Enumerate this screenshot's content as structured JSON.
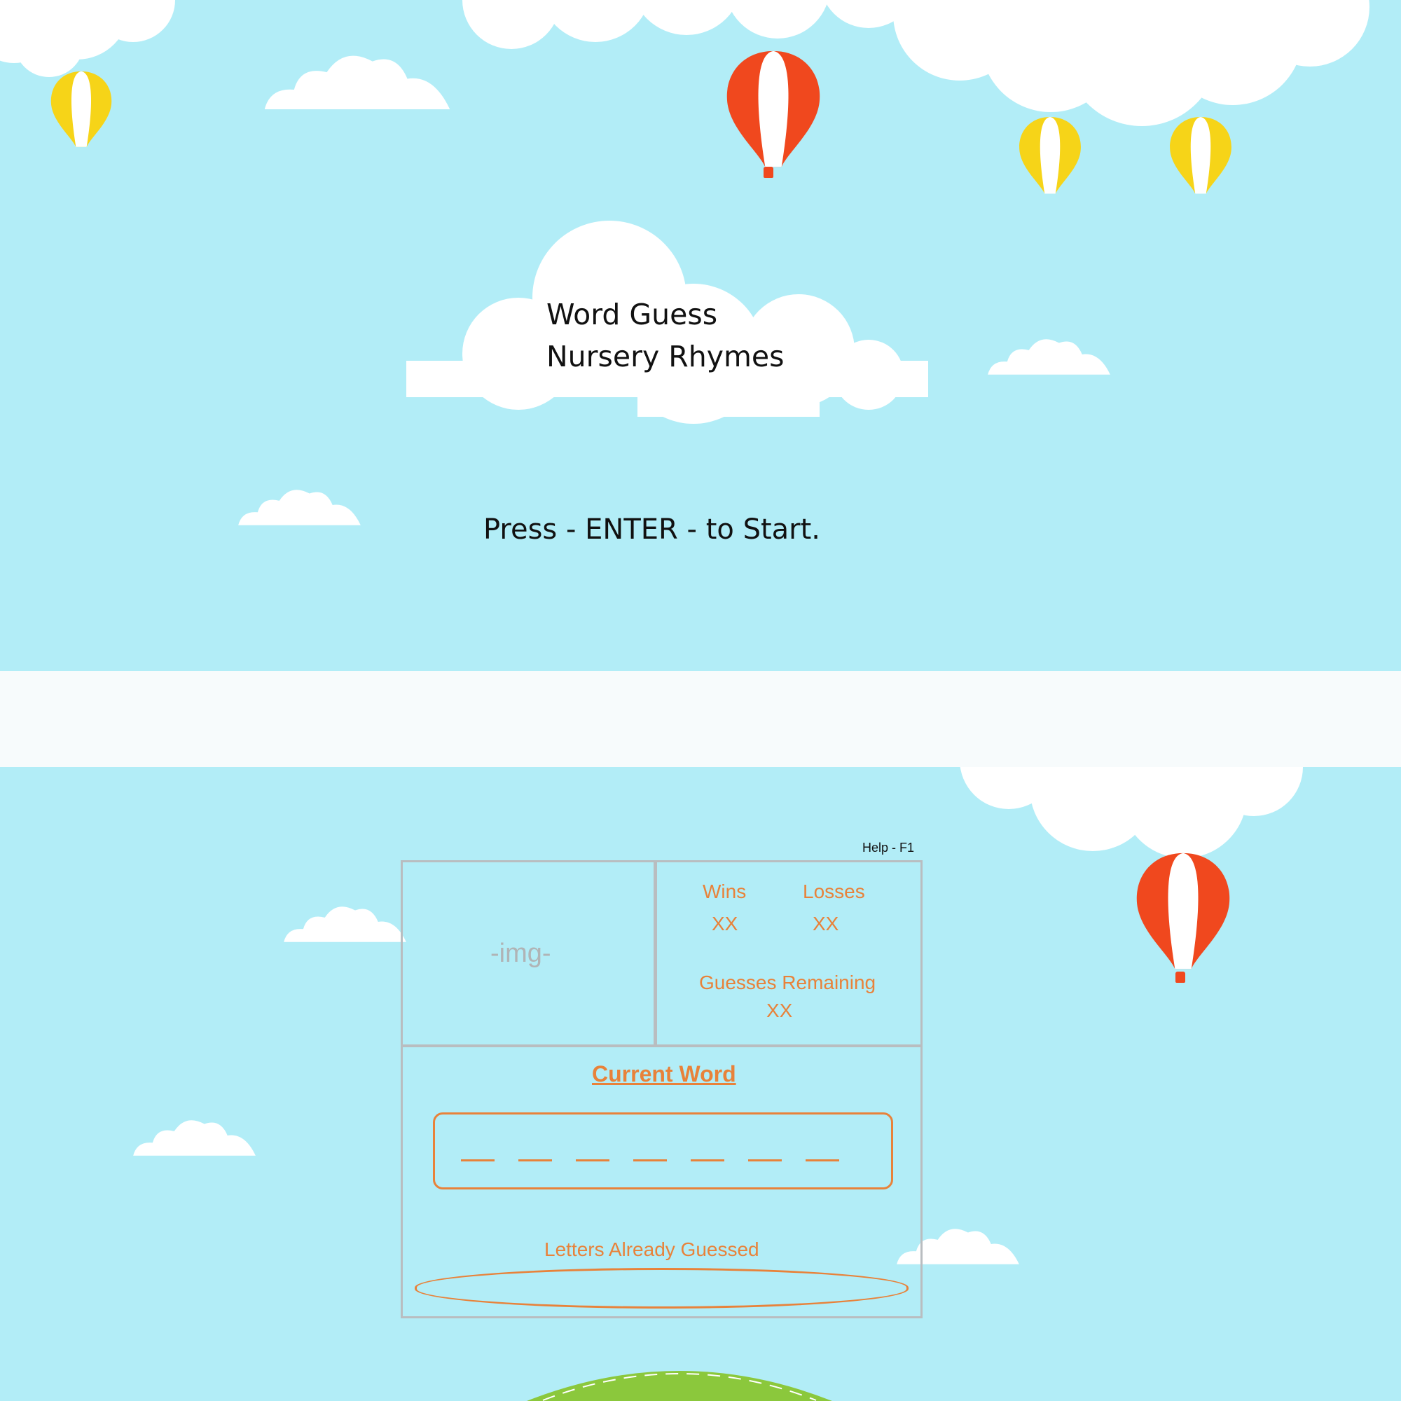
{
  "start_screen": {
    "title_line1": "Word Guess",
    "title_line2": "Nursery Rhymes",
    "start_prompt": "Press - ENTER - to Start."
  },
  "game_screen": {
    "help_label": "Help - F1",
    "image_placeholder": "-img-",
    "wins_label": "Wins",
    "wins_value": "XX",
    "losses_label": "Losses",
    "losses_value": "XX",
    "guesses_remaining_label": "Guesses Remaining",
    "guesses_remaining_value": "XX",
    "current_word_label": "Current Word",
    "current_word_blank_count": 7,
    "letters_guessed_label": "Letters Already Guessed",
    "letters_guessed_value": ""
  },
  "colors": {
    "sky": "#b2edf7",
    "accent_orange": "#e8823a",
    "box_border": "#b9bdc0",
    "balloon_red": "#f0481e",
    "balloon_yellow": "#f6d418",
    "ground_green": "#8bc83c"
  }
}
